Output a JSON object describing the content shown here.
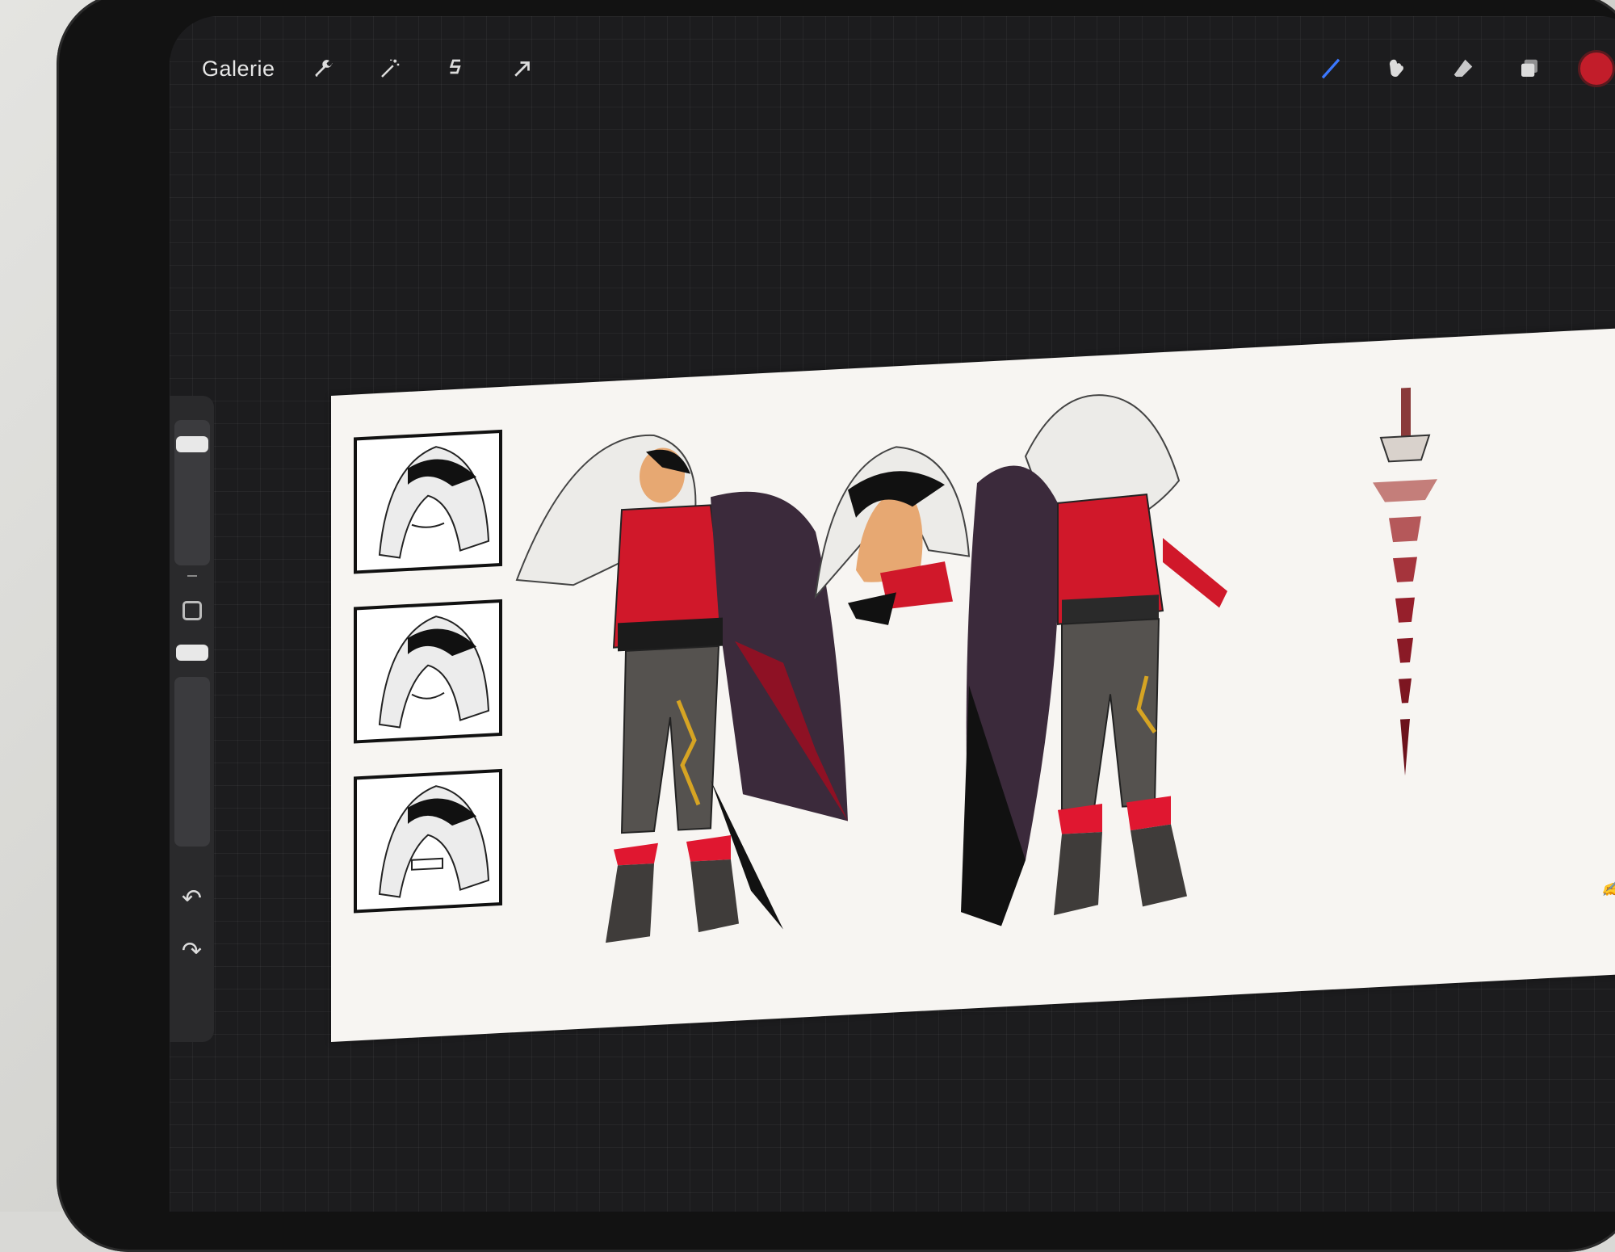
{
  "toolbar": {
    "gallery_label": "Galerie",
    "left_tools": [
      "wrench-icon",
      "magic-wand-icon",
      "selection-icon",
      "transform-arrow-icon"
    ],
    "right_tools": [
      "brush-icon",
      "smudge-icon",
      "eraser-icon",
      "layers-icon"
    ],
    "active_tool": "brush-icon",
    "current_color": "#c21d2a"
  },
  "sidebar": {
    "tools": [
      "brush-size-slider",
      "modify-square-button",
      "opacity-slider",
      "undo-icon",
      "redo-icon"
    ]
  },
  "canvas": {
    "panels": [
      "expression-neutral",
      "expression-smile",
      "expression-angry",
      "full-body-front",
      "head-profile",
      "full-body-back",
      "spine-sword"
    ],
    "palette": {
      "shirt": "#d0182a",
      "hair": "#ecebe8",
      "pants": "#55524f",
      "feathers": "#3b2a3b",
      "boot_cuff": "#e01730",
      "gold": "#d6a423"
    }
  }
}
